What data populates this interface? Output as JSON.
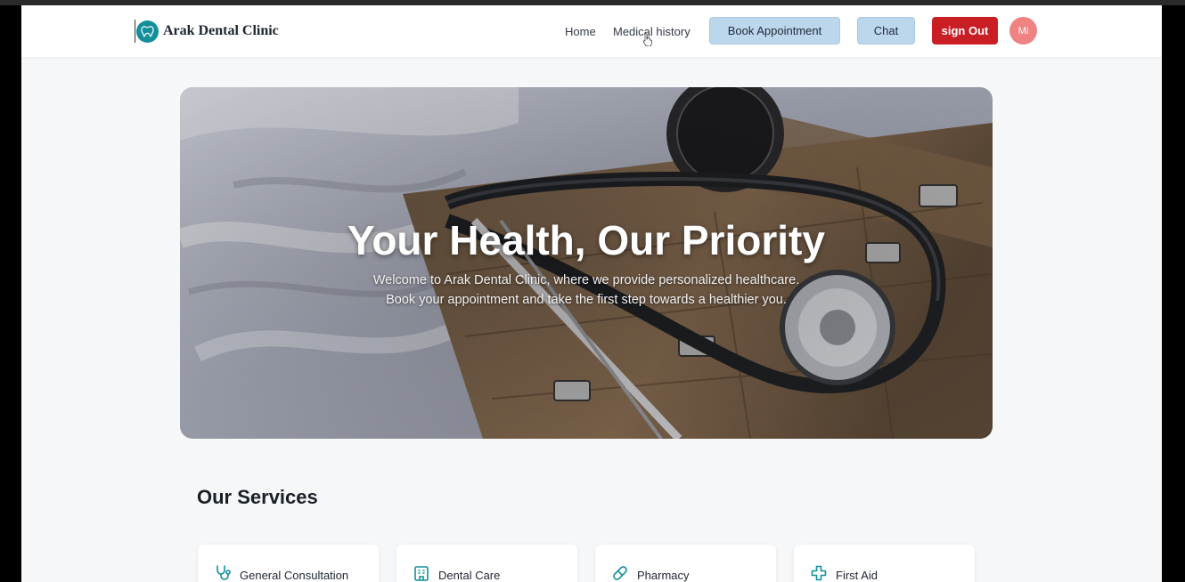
{
  "brand": {
    "name": "Arak Dental Clinic",
    "logo_icon": "dental-logo-icon",
    "accent": "#138f9b"
  },
  "nav": {
    "home": "Home",
    "medical_history": "Medical history",
    "book_appointment": "Book Appointment",
    "chat": "Chat",
    "sign_out": "sign Out",
    "avatar_initials": "Mi"
  },
  "hero": {
    "title": "Your Health, Our Priority",
    "subtitle_line1": "Welcome to Arak Dental Clinic, where we provide personalized healthcare.",
    "subtitle_line2": "Book your appointment and take the first step towards a healthier you."
  },
  "services": {
    "heading": "Our Services",
    "items": [
      {
        "label": "General Consultation",
        "icon": "stethoscope-icon"
      },
      {
        "label": "Dental Care",
        "icon": "hospital-building-icon"
      },
      {
        "label": "Pharmacy",
        "icon": "pill-icon"
      },
      {
        "label": "First Aid",
        "icon": "medical-cross-icon"
      }
    ]
  },
  "colors": {
    "book_button": "#bcd6ec",
    "sign_out_button": "#c81e24",
    "avatar": "#ef8382",
    "page_background": "#f5f7f8"
  }
}
